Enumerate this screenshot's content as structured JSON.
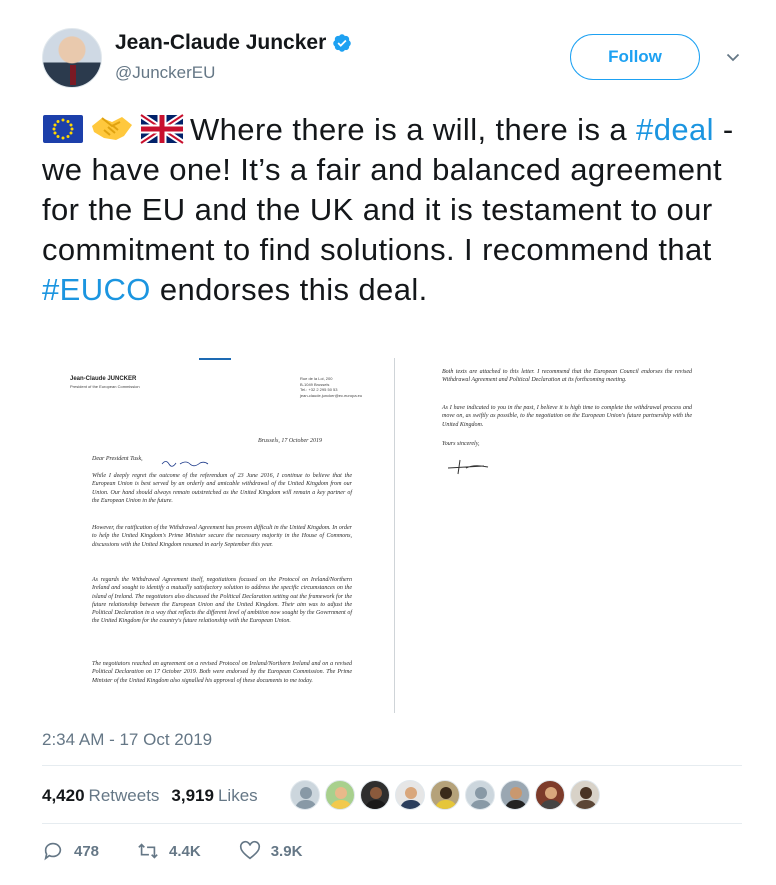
{
  "author": {
    "display_name": "Jean-Claude Juncker",
    "handle": "@JunckerEU",
    "verified": true
  },
  "follow_button": {
    "label": "Follow"
  },
  "tweet": {
    "emojis": [
      "eu-flag-icon",
      "handshake-icon",
      "uk-flag-icon"
    ],
    "text_part1": "Where there is a will, there is a",
    "hashtag1": "#deal",
    "text_part2": "- we have one! It’s a fair and balanced agreement for the EU and the UK and it is testament to our commitment to find solutions. I recommend that",
    "hashtag2": "#EUCO",
    "text_part3": "endorses this deal."
  },
  "letter": {
    "sender": "Jean-Claude JUNCKER",
    "sender_title": "President of the European Commission",
    "address": "Rue de la Loi, 200\nB-1049 Brussels\nTel.: +32 2 295 50 53\njean-claude.juncker@ec.europa.eu",
    "date": "Brussels, 17 October 2019",
    "salutation": "Dear President Tusk,",
    "para1": "While I deeply regret the outcome of the referendum of 23 June 2016, I continue to believe that the European Union is best served by an orderly and amicable withdrawal of the United Kingdom from our Union. Our hand should always remain outstretched as the United Kingdom will remain a key partner of the European Union in the future.",
    "para2": "However, the ratification of the Withdrawal Agreement has proven difficult in the United Kingdom. In order to help the United Kingdom's Prime Minister secure the necessary majority in the House of Commons, discussions with the United Kingdom resumed in early September this year.",
    "para3": "As regards the Withdrawal Agreement itself, negotiations focused on the Protocol on Ireland/Northern Ireland and sought to identify a mutually satisfactory solution to address the specific circumstances on the island of Ireland. The negotiators also discussed the Political Declaration setting out the framework for the future relationship between the European Union and the United Kingdom. Their aim was to adjust the Political Declaration in a way that reflects the different level of ambition now sought by the Government of the United Kingdom for the country's future relationship with the European Union.",
    "para4": "The negotiators reached an agreement on a revised Protocol on Ireland/Northern Ireland and on a revised Political Declaration on 17 October 2019. Both were endorsed by the European Commission. The Prime Minister of the United Kingdom also signalled his approval of these documents to me today.",
    "page2_para1": "Both texts are attached to this letter. I recommend that the European Council endorses the revised Withdrawal Agreement and Political Declaration at its forthcoming meeting.",
    "page2_para2": "As I have indicated to you in the past, I believe it is high time to complete the withdrawal process and move on, as swiftly as possible, to the negotiation on the European Union's future partnership with the United Kingdom.",
    "closing": "Yours sincerely,"
  },
  "timestamp": "2:34 AM - 17 Oct 2019",
  "stats": {
    "retweets_count": "4,420",
    "retweets_label": "Retweets",
    "likes_count": "3,919",
    "likes_label": "Likes"
  },
  "liker_avatars": 9,
  "actions": {
    "reply_count": "478",
    "retweet_count": "4.4K",
    "like_count": "3.9K"
  },
  "colors": {
    "accent": "#1da1f2",
    "hashtag": "#1b95e0",
    "muted": "#657786",
    "text": "#14171a"
  }
}
